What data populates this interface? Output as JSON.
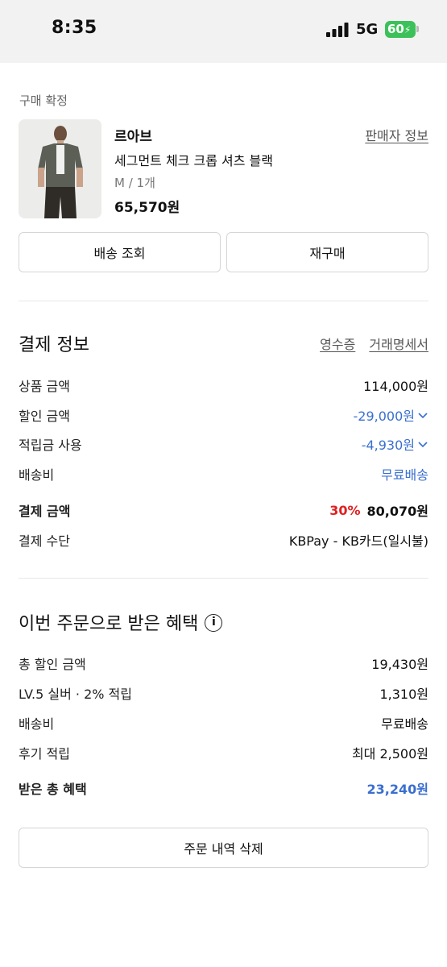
{
  "status_bar": {
    "time": "8:35",
    "network": "5G",
    "battery": "60"
  },
  "order": {
    "status_label": "구매 확정",
    "brand": "르아브",
    "seller_info_link": "판매자 정보",
    "product_name": "세그먼트 체크 크롭 셔츠 블랙",
    "option": "M / 1개",
    "price": "65,570원",
    "ship_tracking_button": "배송 조회",
    "rebuy_button": "재구매"
  },
  "payment": {
    "title": "결제 정보",
    "receipt_link": "영수증",
    "statement_link": "거래명세서",
    "rows": [
      {
        "label": "상품 금액",
        "value": "114,000원"
      },
      {
        "label": "할인 금액",
        "value": "-29,000원"
      },
      {
        "label": "적립금 사용",
        "value": "-4,930원"
      },
      {
        "label": "배송비",
        "value": "무료배송"
      }
    ],
    "total_label": "결제 금액",
    "total_discount_rate": "30%",
    "total_value": "80,070원",
    "method_label": "결제 수단",
    "method_value": "KBPay - KB카드(일시불)"
  },
  "benefits": {
    "title": "이번 주문으로 받은 혜택",
    "rows": [
      {
        "label": "총 할인 금액",
        "value": "19,430원"
      },
      {
        "label": "LV.5 실버 · 2% 적립",
        "value": "1,310원"
      },
      {
        "label": "배송비",
        "value": "무료배송"
      },
      {
        "label": "후기 적립",
        "value": "최대 2,500원"
      }
    ],
    "total_label": "받은 총 혜택",
    "total_value": "23,240원"
  },
  "delete_order_button": "주문 내역 삭제",
  "colors": {
    "accent_blue": "#3a6fd0",
    "discount_red": "#e02020",
    "battery_green": "#3cc15a"
  }
}
